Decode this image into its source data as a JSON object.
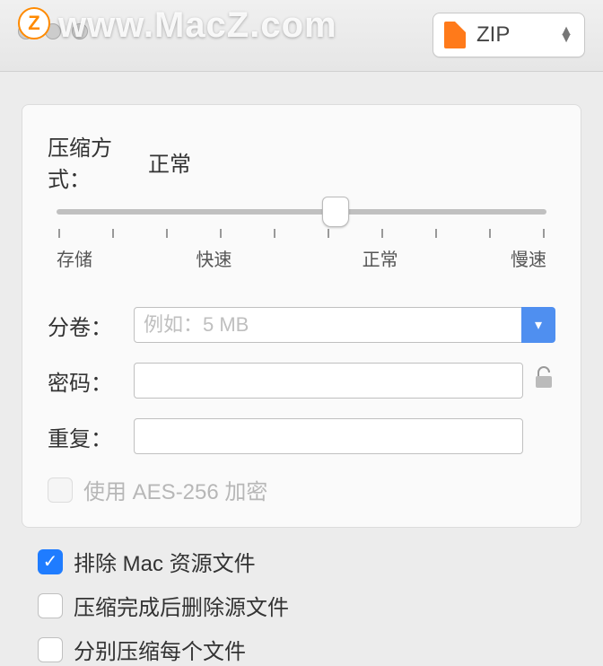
{
  "watermark": "www.MacZ.com",
  "app_icon_letter": "Z",
  "format": {
    "selected": "ZIP"
  },
  "compression": {
    "label": "压缩方式：",
    "value": "正常",
    "ticks": [
      "存储",
      "快速",
      "正常",
      "慢速"
    ]
  },
  "volume": {
    "label": "分卷：",
    "placeholder": "例如：5 MB",
    "value": ""
  },
  "password": {
    "label": "密码：",
    "value": ""
  },
  "repeat": {
    "label": "重复：",
    "value": ""
  },
  "aes": {
    "label": "使用 AES-256 加密",
    "checked": false,
    "disabled": true
  },
  "options": [
    {
      "label": "排除 Mac 资源文件",
      "checked": true
    },
    {
      "label": "压缩完成后删除源文件",
      "checked": false
    },
    {
      "label": "分别压缩每个文件",
      "checked": false
    }
  ]
}
